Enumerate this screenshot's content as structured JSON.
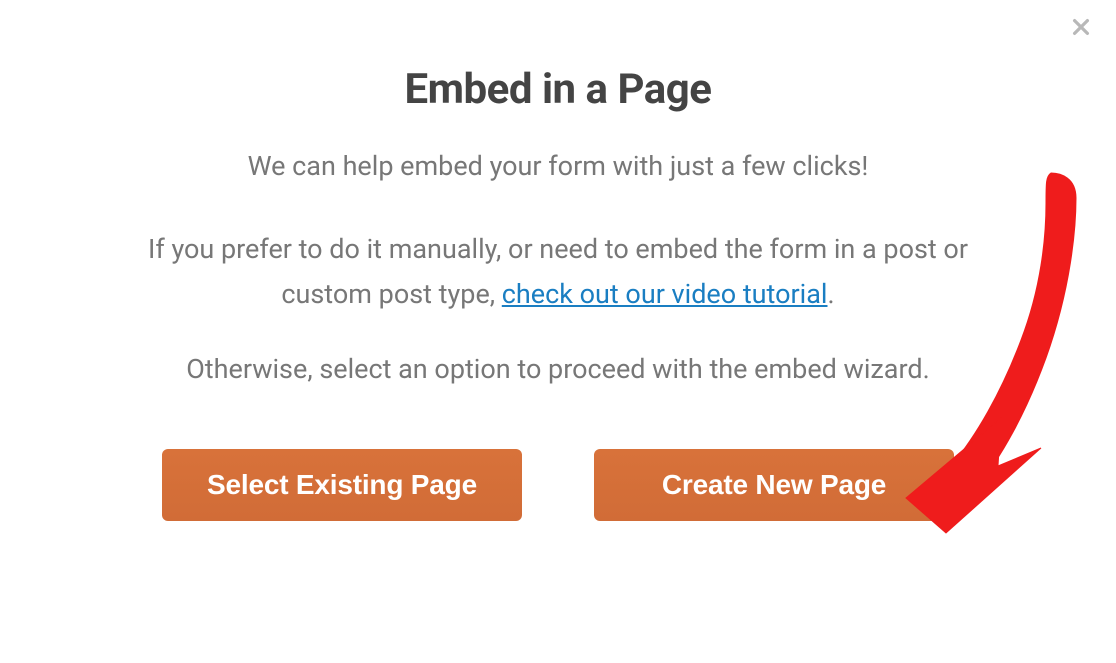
{
  "modal": {
    "title": "Embed in a Page",
    "subtitle": "We can help embed your form with just a few clicks!",
    "para_prefix": "If you prefer to do it manually, or need to embed the form in a post or custom post type, ",
    "para_link": "check out our video tutorial",
    "para_suffix": ".",
    "para2": "Otherwise, select an option to proceed with the embed wizard.",
    "buttons": {
      "select_existing": "Select Existing Page",
      "create_new": "Create New Page"
    }
  }
}
